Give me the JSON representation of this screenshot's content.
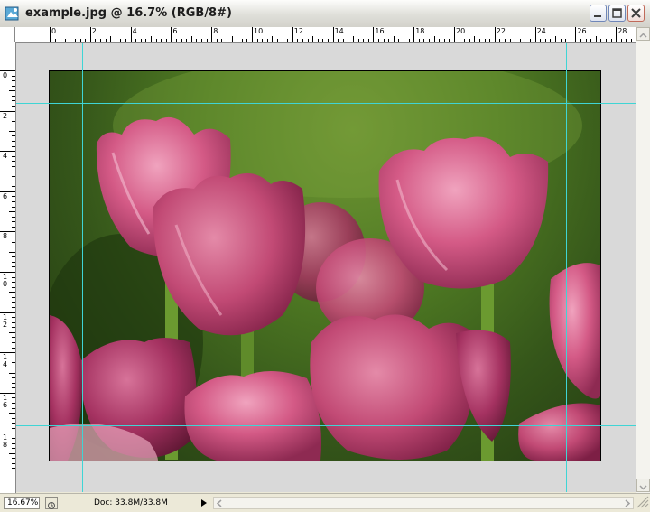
{
  "window": {
    "title": "example.jpg @ 16.7% (RGB/8#)"
  },
  "ruler_top": {
    "labels": [
      "0",
      "2",
      "4",
      "6",
      "8",
      "10",
      "12",
      "14",
      "16",
      "18",
      "20",
      "22",
      "24",
      "26",
      "28"
    ]
  },
  "ruler_left": {
    "labels": [
      "0",
      "2",
      "4",
      "6",
      "8",
      "1\n0",
      "1\n2",
      "1\n4",
      "1\n6",
      "1\n8"
    ]
  },
  "status": {
    "zoom": "16.67%",
    "doc": "Doc: 33.8M/33.8M"
  },
  "image": {
    "description_icon": "photo-tulips",
    "colors": {
      "pink": "#c8466f",
      "light_pink": "#e889a6",
      "stem": "#5f8b2a",
      "background_green": "#4f7a23"
    }
  },
  "icons": {
    "app": "photoshop-document-icon",
    "minimize": "minimize-icon",
    "maximize": "maximize-icon",
    "close": "close-icon"
  }
}
